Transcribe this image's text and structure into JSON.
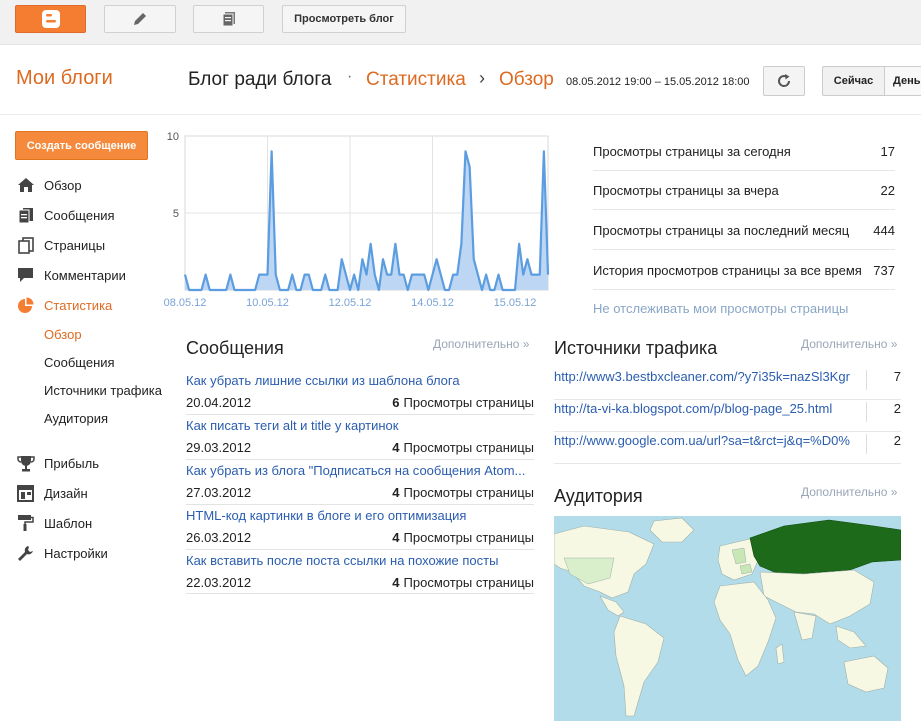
{
  "toolbar": {
    "view_blog_label": "Просмотреть блог"
  },
  "header": {
    "my_blogs": "Мои блоги",
    "blog_name": "Блог ради блога",
    "separator": "·",
    "section": "Статистика",
    "arrow": "›",
    "page": "Обзор",
    "date_range": "08.05.2012 19:00 – 15.05.2012 18:00",
    "now_label": "Сейчас",
    "day_label": "День"
  },
  "sidebar": {
    "create_post": "Создать сообщение",
    "items": [
      {
        "label": "Обзор",
        "icon": "home-icon"
      },
      {
        "label": "Сообщения",
        "icon": "posts-icon"
      },
      {
        "label": "Страницы",
        "icon": "pages-icon"
      },
      {
        "label": "Комментарии",
        "icon": "comment-icon"
      },
      {
        "label": "Статистика",
        "icon": "pie-chart-icon",
        "active": true
      },
      {
        "label": "Прибыль",
        "icon": "trophy-icon"
      },
      {
        "label": "Дизайн",
        "icon": "layout-icon"
      },
      {
        "label": "Шаблон",
        "icon": "paint-roller-icon"
      },
      {
        "label": "Настройки",
        "icon": "wrench-icon"
      }
    ],
    "stats_sub": [
      {
        "label": "Обзор",
        "active": true
      },
      {
        "label": "Сообщения"
      },
      {
        "label": "Источники трафика"
      },
      {
        "label": "Аудитория"
      }
    ]
  },
  "chart_data": {
    "type": "area",
    "x": [
      "08.05.12",
      "",
      "",
      "",
      "",
      "",
      "",
      "",
      "",
      "",
      "",
      "",
      "",
      "",
      "",
      "",
      "",
      "",
      "",
      "",
      "10.05.12",
      "",
      "",
      "",
      "",
      "",
      "",
      "",
      "",
      "",
      "",
      "",
      "",
      "",
      "",
      "",
      "",
      "",
      "",
      "",
      "12.05.12",
      "",
      "",
      "",
      "",
      "",
      "",
      "",
      "",
      "",
      "",
      "",
      "",
      "",
      "",
      "",
      "",
      "",
      "",
      "",
      "14.05.12",
      "",
      "",
      "",
      "",
      "",
      "",
      "",
      "",
      "",
      "",
      "",
      "",
      "",
      "",
      "",
      "",
      "",
      "",
      "",
      "15.05.12"
    ],
    "values": [
      1,
      0,
      0,
      0,
      0,
      1,
      0,
      0,
      0,
      0,
      0,
      1,
      0,
      0,
      0,
      0,
      0,
      0,
      1,
      1,
      1,
      9,
      1,
      0,
      0,
      0,
      1,
      0,
      0,
      1,
      1,
      0,
      0,
      0,
      1,
      0,
      0,
      0,
      2,
      1,
      0,
      1,
      0,
      2,
      1,
      3,
      1,
      0,
      2,
      1,
      1,
      3,
      1,
      1,
      0,
      1,
      1,
      1,
      1,
      0,
      1,
      2,
      1,
      0,
      0,
      1,
      1,
      3,
      9,
      8,
      2,
      1,
      0,
      1,
      0,
      0,
      1,
      0,
      0,
      0,
      0,
      3,
      1,
      2,
      1,
      1,
      1,
      9,
      1
    ],
    "x_ticks": [
      "08.05.12",
      "10.05.12",
      "12.05.12",
      "14.05.12",
      "15.05.12"
    ],
    "y_ticks": [
      "10",
      "5"
    ],
    "ylim": [
      0,
      10
    ],
    "grid": true,
    "colors": {
      "line": "#5b9de0",
      "fill": "#bcd6f3"
    }
  },
  "stats": [
    {
      "label": "Просмотры страницы за сегодня",
      "value": "17"
    },
    {
      "label": "Просмотры страницы за вчера",
      "value": "22"
    },
    {
      "label": "Просмотры страницы за последний месяц",
      "value": "444"
    },
    {
      "label": "История просмотров страницы за все время",
      "value": "737"
    }
  ],
  "no_track_link": "Не отслеживать мои просмотры страницы",
  "posts": {
    "title": "Сообщения",
    "more": "Дополнительно »",
    "views_label": "Просмотры страницы",
    "items": [
      {
        "title": "Как убрать лишние ссылки из шаблона блога",
        "date": "20.04.2012",
        "views": "6"
      },
      {
        "title": "Как писать теги alt и title у картинок",
        "date": "29.03.2012",
        "views": "4"
      },
      {
        "title": "Как убрать из блога \"Подписаться на сообщения Atom...",
        "date": "27.03.2012",
        "views": "4"
      },
      {
        "title": "HTML-код картинки в блоге и его оптимизация",
        "date": "26.03.2012",
        "views": "4"
      },
      {
        "title": "Как вставить после поста ссылки на похожие посты",
        "date": "22.03.2012",
        "views": "4"
      }
    ]
  },
  "traffic": {
    "title": "Источники трафика",
    "more": "Дополнительно »",
    "items": [
      {
        "url": "http://www3.bestbxcleaner.com/?y7i35k=nazSl3Kgr",
        "count": "7"
      },
      {
        "url": "http://ta-vi-ka.blogspot.com/p/blog-page_25.html",
        "count": "2"
      },
      {
        "url": "http://www.google.com.ua/url?sa=t&rct=j&q=%D0%",
        "count": "2"
      }
    ]
  },
  "audience": {
    "title": "Аудитория",
    "more": "Дополнительно »",
    "colors": {
      "ocean": "#b2dcea",
      "land": "#f7f8e4",
      "top": "#1d6b1a",
      "low": "#c9e6b6"
    }
  }
}
